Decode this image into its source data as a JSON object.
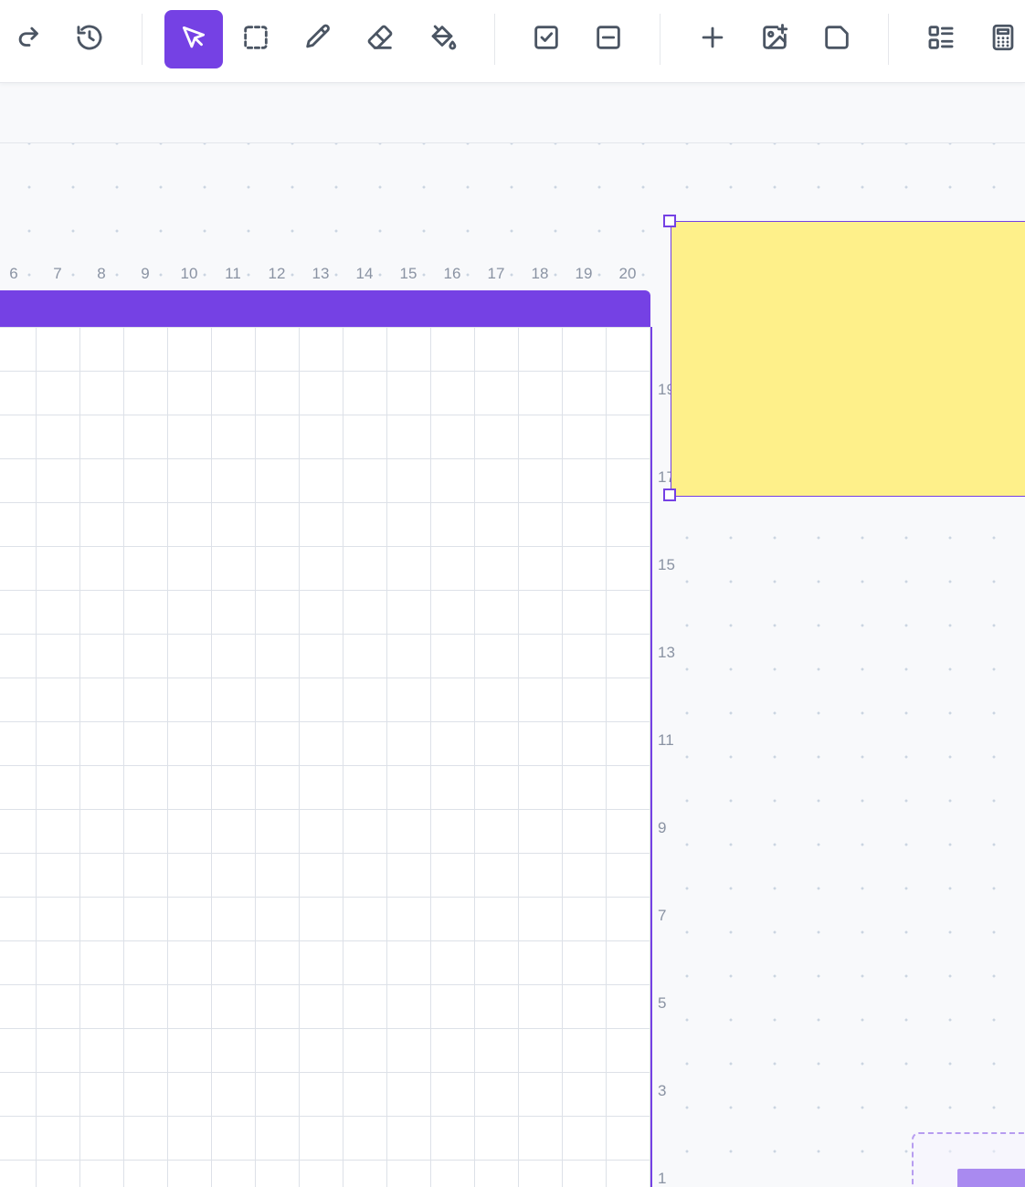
{
  "toolbar": {
    "tools": [
      {
        "id": "redo",
        "icon": "redo-icon",
        "active": false
      },
      {
        "id": "history",
        "icon": "history-icon",
        "active": false
      },
      {
        "id": "select",
        "icon": "pointer-icon",
        "active": true
      },
      {
        "id": "marquee",
        "icon": "dashed-square-icon",
        "active": false
      },
      {
        "id": "pencil",
        "icon": "pencil-icon",
        "active": false
      },
      {
        "id": "eraser",
        "icon": "eraser-icon",
        "active": false
      },
      {
        "id": "fill",
        "icon": "paint-bucket-icon",
        "active": false
      },
      {
        "id": "checkbox",
        "icon": "checkbox-icon",
        "active": false
      },
      {
        "id": "minus-box",
        "icon": "minus-square-icon",
        "active": false
      },
      {
        "id": "add",
        "icon": "plus-icon",
        "active": false
      },
      {
        "id": "add-image",
        "icon": "image-plus-icon",
        "active": false
      },
      {
        "id": "sticky-note",
        "icon": "sticky-note-icon",
        "active": false
      },
      {
        "id": "list-layout",
        "icon": "list-layout-icon",
        "active": false
      },
      {
        "id": "calculator",
        "icon": "calculator-icon",
        "active": false
      }
    ]
  },
  "board": {
    "header_color": "#7541e4",
    "x_axis_labels": [
      "6",
      "7",
      "8",
      "9",
      "10",
      "11",
      "12",
      "13",
      "14",
      "15",
      "16",
      "17",
      "18",
      "19",
      "20"
    ],
    "y_axis_labels": [
      "19",
      "17",
      "15",
      "13",
      "11",
      "9",
      "7",
      "5",
      "3",
      "1"
    ]
  },
  "sticky_note": {
    "color": "#fef08a",
    "text": ""
  },
  "colors": {
    "accent": "#7541e4",
    "canvas": "#f8f9fb",
    "grid_line": "#dde1e8",
    "label": "#8a93a3"
  }
}
